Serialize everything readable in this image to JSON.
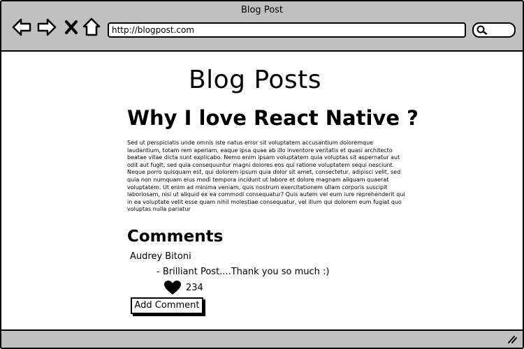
{
  "window": {
    "title": "Blog Post"
  },
  "browser": {
    "url": "http://blogpost.com"
  },
  "page": {
    "heading": "Blog Posts",
    "post_title": "Why I love React Native ?",
    "post_body": "Sed ut perspiciatis unde omnis iste natus error sit voluptatem accusantium doloremque laudantium, totam rem aperiam, eaque ipsa quae ab illo inventore veritatis et quasi architecto beatae vitae dicta sunt explicabo. Nemo enim ipsam voluptatem quia voluptas sit aspernatur aut odit aut fugit, sed quia consequuntur magni dolores eos qui ratione voluptatem sequi nesciunt. Neque porro quisquam est, qui dolorem ipsum quia dolor sit amet, consectetur, adipisci velit, sed quia non numquam eius modi tempora incidunt ut labore et dolore magnam aliquam quaerat voluptatem. Ut enim ad minima veniam, quis nostrum exercitationem ullam corporis suscipit laboriosam, nisi ut aliquid ex ea commodi consequatur? Quis autem vel eum iure reprehenderit qui in ea voluptate velit esse quam nihil molestiae consequatur, vel illum qui dolorem eum fugiat quo voluptas nulla pariatur",
    "comments_heading": "Comments",
    "comment": {
      "author": "Audrey Bitoni",
      "text": "- Brilliant Post....Thank you so much :)",
      "likes": "234"
    },
    "add_comment_label": "Add Comment"
  },
  "icons": [
    "back-icon",
    "forward-icon",
    "close-icon",
    "home-icon",
    "search-icon",
    "heart-icon",
    "resize-grip-icon"
  ]
}
